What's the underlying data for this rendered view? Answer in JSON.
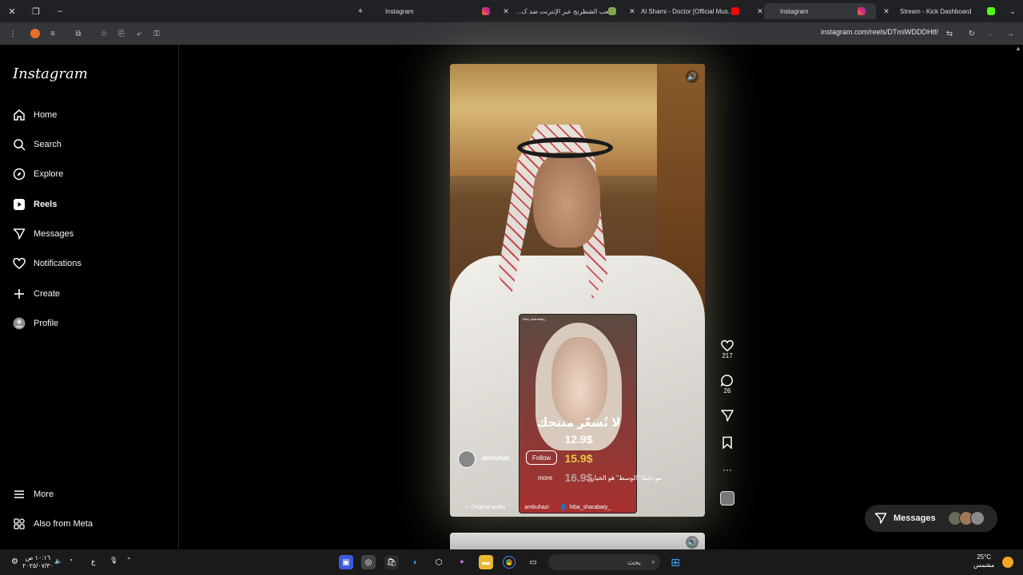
{
  "browser": {
    "tabs": [
      {
        "title": "Instagram",
        "icon": "instagram-icon",
        "color": "#e1306c"
      },
      {
        "title": "لعب الشطرنج عبر الإنترنت ضد ک...",
        "icon": "chess-icon",
        "color": "#7fa650"
      },
      {
        "title": "Al Shami - Doctor [Official Mus...",
        "icon": "youtube-icon",
        "color": "#ff0000"
      },
      {
        "title": "Instagram",
        "icon": "instagram-icon",
        "color": "#e1306c",
        "active": true
      },
      {
        "title": "Stream - Kick Dashboard",
        "icon": "kick-icon",
        "color": "#53fc18"
      }
    ],
    "url": "instagram.com/reels/DTmiWDDDHtf/"
  },
  "sidebar": {
    "logo": "Instagram",
    "items": [
      {
        "label": "Home",
        "icon": "home-icon"
      },
      {
        "label": "Search",
        "icon": "search-icon"
      },
      {
        "label": "Explore",
        "icon": "compass-icon"
      },
      {
        "label": "Reels",
        "icon": "reels-icon",
        "active": true
      },
      {
        "label": "Messages",
        "icon": "messages-icon"
      },
      {
        "label": "Notifications",
        "icon": "heart-icon"
      },
      {
        "label": "Create",
        "icon": "plus-icon"
      },
      {
        "label": "Profile",
        "icon": "avatar-icon"
      }
    ],
    "bottom": [
      {
        "label": "More",
        "icon": "menu-icon"
      },
      {
        "label": "Also from Meta",
        "icon": "meta-icon"
      }
    ]
  },
  "reel": {
    "username": "ambuhaz",
    "follow_label": "Follow",
    "caption": "مو دايمًا \"الوسط\" هو الخيار...",
    "more_label": "more",
    "audio": "Original audio",
    "audio_user": "ambuhazi",
    "tagged_user": "hiba_sharabaty_",
    "inner_video": {
      "username": "hiba_sharabaty_",
      "headline": "لا تُسعّر منتجك",
      "prices": [
        "12.9$",
        "15.9$",
        "16.9$"
      ]
    }
  },
  "actions": {
    "likes": "217",
    "comments": "26"
  },
  "messages_pill": {
    "label": "Messages"
  },
  "taskbar": {
    "time": "١٠:١٦ ص",
    "date": "٢٠٢٥/٠٧/٣٠",
    "search_placeholder": "بحث",
    "weather_temp": "25°C",
    "weather_desc": "مشمس",
    "lang": "ع"
  }
}
